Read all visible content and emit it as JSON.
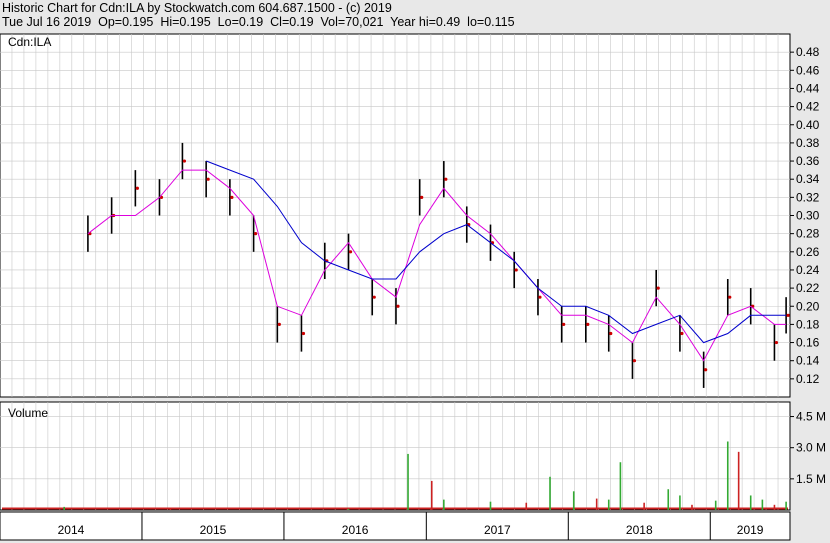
{
  "header": {
    "line1": "Historic Chart for Cdn:ILA by Stockwatch.com 604.687.1500 - (c) 2019",
    "line2": "Tue Jul 16 2019  Op=0.195  Hi=0.195  Lo=0.19  Cl=0.19  Vol=70,021  Year hi=0.49  lo=0.115"
  },
  "colors": {
    "price_bar": "#000000",
    "close_dot": "#cc0000",
    "ma_short": "#dd00dd",
    "ma_long": "#0000cc",
    "volume_up": "#33aa33",
    "volume_down": "#cc2222",
    "grid": "#c8c8c8",
    "panel_bg": "#ffffff",
    "page_bg": "#e8e8e8"
  },
  "chart_data": [
    {
      "type": "line",
      "panel": "price",
      "symbol": "Cdn:ILA",
      "ylim": [
        0.1,
        0.5
      ],
      "yticks": [
        "0.12",
        "0.14",
        "0.16",
        "0.18",
        "0.20",
        "0.22",
        "0.24",
        "0.26",
        "0.28",
        "0.30",
        "0.32",
        "0.34",
        "0.36",
        "0.38",
        "0.40",
        "0.42",
        "0.44",
        "0.46",
        "0.48"
      ],
      "x_labels": [
        "2014",
        "2015",
        "2016",
        "2017",
        "2018",
        "2019"
      ],
      "grid": true,
      "series": [
        {
          "kind": "ohlc-close",
          "x": [
            "2014-08",
            "2014-10",
            "2014-12",
            "2015-02",
            "2015-04",
            "2015-06",
            "2015-08",
            "2015-10",
            "2015-12",
            "2016-02",
            "2016-04",
            "2016-06",
            "2016-08",
            "2016-10",
            "2016-12",
            "2017-02",
            "2017-04",
            "2017-06",
            "2017-08",
            "2017-10",
            "2017-12",
            "2018-02",
            "2018-04",
            "2018-06",
            "2018-08",
            "2018-10",
            "2018-12",
            "2019-02",
            "2019-04",
            "2019-06",
            "2019-07"
          ],
          "values": [
            0.28,
            0.3,
            0.33,
            0.32,
            0.36,
            0.34,
            0.32,
            0.28,
            0.18,
            0.17,
            0.25,
            0.26,
            0.21,
            0.2,
            0.32,
            0.34,
            0.29,
            0.27,
            0.24,
            0.21,
            0.18,
            0.18,
            0.17,
            0.14,
            0.22,
            0.17,
            0.13,
            0.21,
            0.2,
            0.16,
            0.19
          ]
        },
        {
          "kind": "moving-average-short",
          "x": [
            "2014-08",
            "2014-10",
            "2014-12",
            "2015-02",
            "2015-04",
            "2015-06",
            "2015-08",
            "2015-10",
            "2015-12",
            "2016-02",
            "2016-04",
            "2016-06",
            "2016-08",
            "2016-10",
            "2016-12",
            "2017-02",
            "2017-04",
            "2017-06",
            "2017-08",
            "2017-10",
            "2017-12",
            "2018-02",
            "2018-04",
            "2018-06",
            "2018-08",
            "2018-10",
            "2018-12",
            "2019-02",
            "2019-04",
            "2019-06",
            "2019-07"
          ],
          "values": [
            0.28,
            0.3,
            0.3,
            0.32,
            0.35,
            0.35,
            0.33,
            0.3,
            0.2,
            0.19,
            0.24,
            0.27,
            0.23,
            0.21,
            0.29,
            0.33,
            0.3,
            0.28,
            0.25,
            0.22,
            0.19,
            0.19,
            0.18,
            0.16,
            0.21,
            0.18,
            0.14,
            0.19,
            0.2,
            0.18,
            0.18
          ]
        },
        {
          "kind": "moving-average-long",
          "x": [
            "2015-06",
            "2015-08",
            "2015-10",
            "2015-12",
            "2016-02",
            "2016-04",
            "2016-06",
            "2016-08",
            "2016-10",
            "2016-12",
            "2017-02",
            "2017-04",
            "2017-06",
            "2017-08",
            "2017-10",
            "2017-12",
            "2018-02",
            "2018-04",
            "2018-06",
            "2018-08",
            "2018-10",
            "2018-12",
            "2019-02",
            "2019-04",
            "2019-06",
            "2019-07"
          ],
          "values": [
            0.36,
            0.35,
            0.34,
            0.31,
            0.27,
            0.25,
            0.24,
            0.23,
            0.23,
            0.26,
            0.28,
            0.29,
            0.27,
            0.25,
            0.22,
            0.2,
            0.2,
            0.19,
            0.17,
            0.18,
            0.19,
            0.16,
            0.17,
            0.19,
            0.19,
            0.19
          ]
        }
      ]
    },
    {
      "type": "bar",
      "panel": "volume",
      "title": "Volume",
      "ylim": [
        0,
        5.2
      ],
      "yticks": [
        "1.5 M",
        "3.0 M",
        "4.5 M"
      ],
      "ytick_values": [
        1.5,
        3.0,
        4.5
      ],
      "x_labels": [
        "2014",
        "2015",
        "2016",
        "2017",
        "2018",
        "2019"
      ],
      "series": [
        {
          "name": "",
          "x": [
            "2014-06",
            "2015-03",
            "2016-06",
            "2016-11",
            "2017-01",
            "2017-02",
            "2017-06",
            "2017-09",
            "2017-11",
            "2018-01",
            "2018-03",
            "2018-04",
            "2018-05",
            "2018-07",
            "2018-09",
            "2018-10",
            "2018-11",
            "2019-01",
            "2019-02",
            "2019-03",
            "2019-04",
            "2019-05",
            "2019-06",
            "2019-07"
          ],
          "values": [
            0.15,
            0.08,
            0.06,
            2.7,
            1.4,
            0.5,
            0.4,
            0.35,
            1.6,
            0.9,
            0.55,
            0.5,
            2.3,
            0.35,
            1.0,
            0.7,
            0.25,
            0.45,
            3.3,
            2.8,
            0.7,
            0.5,
            0.25,
            0.4
          ]
        }
      ]
    }
  ]
}
